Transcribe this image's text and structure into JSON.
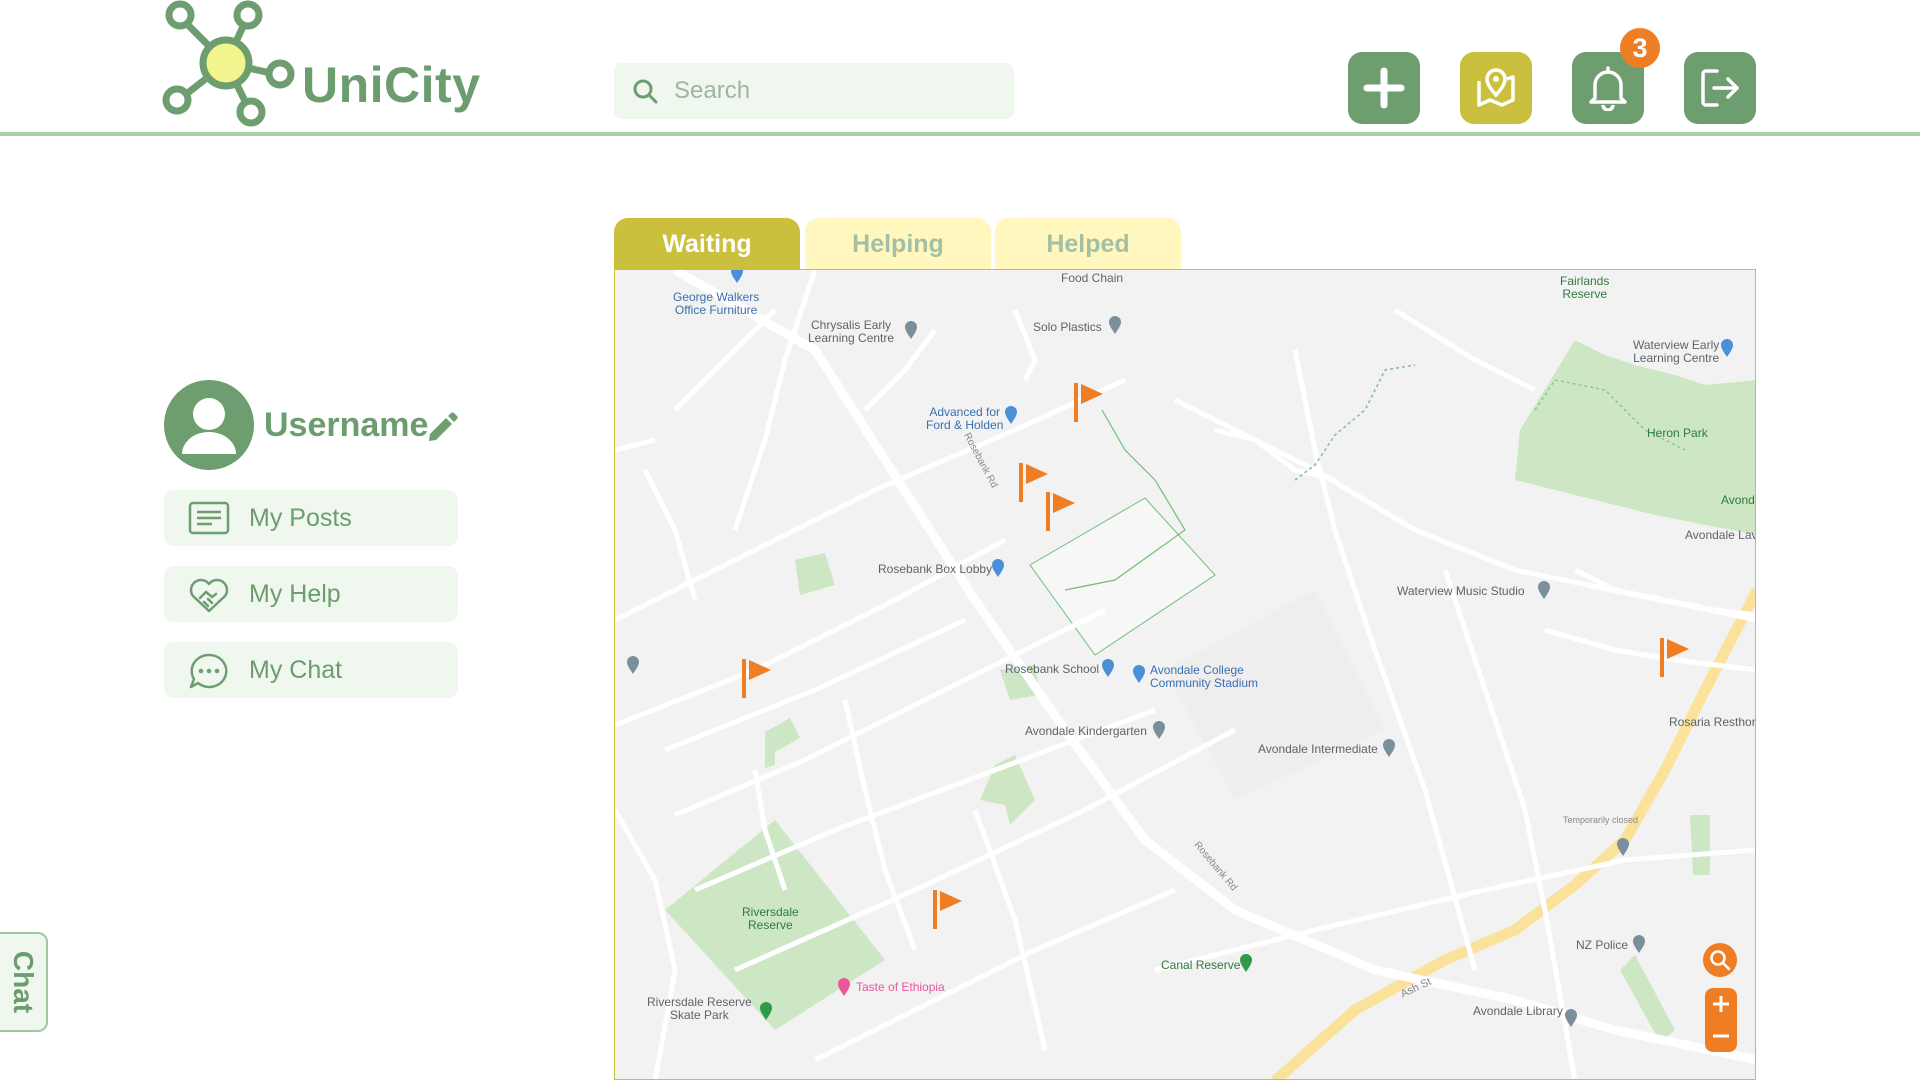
{
  "app": {
    "name": "UniCity"
  },
  "search": {
    "placeholder": "Search"
  },
  "header": {
    "notification_count": "3",
    "buttons": [
      "plus-icon",
      "map-pin-icon",
      "bell-icon",
      "logout-icon"
    ]
  },
  "profile": {
    "username": "Username"
  },
  "nav": {
    "items": [
      {
        "label": "My Posts",
        "icon": "posts-icon"
      },
      {
        "label": "My Help",
        "icon": "heart-handshake-icon"
      },
      {
        "label": "My Chat",
        "icon": "chat-bubble-icon"
      }
    ]
  },
  "tabs": [
    {
      "label": "Waiting",
      "active": true
    },
    {
      "label": "Helping",
      "active": false
    },
    {
      "label": "Helped",
      "active": false
    }
  ],
  "chat_tab": {
    "label": "Chat"
  },
  "map": {
    "labels": {
      "george": "George Walkers",
      "george2": "Office Furniture",
      "chrysalis": "Chrysalis Early",
      "chrysalis2": "Learning Centre",
      "foodchain": "Food Chain",
      "solo": "Solo Plastics",
      "fairlands": "Fairlands",
      "fairlands2": "Reserve",
      "waterview_early": "Waterview Early",
      "waterview_early2": "Learning Centre",
      "heron": "Heron Park",
      "advanced": "Advanced for",
      "advanced2": "Ford & Holden",
      "avondale_lav": "Avondale Lav",
      "rosebank_box": "Rosebank Box Lobby",
      "waterview_music": "Waterview Music Studio",
      "rosebank_school": "Rosebank School",
      "avondale_college": "Avondale College",
      "avondale_college2": "Community Stadium",
      "avondale_kinder": "Avondale Kindergarten",
      "avondale_inter": "Avondale Intermediate",
      "rosaria": "Rosaria Resthor",
      "temp_closed": "Temporarily closed",
      "riversdale": "Riversdale",
      "riversdale2": "Reserve",
      "canal": "Canal Reserve",
      "nz_police": "NZ Police",
      "riversdale_skate": "Riversdale Reserve",
      "riversdale_skate2": "Skate Park",
      "taste": "Taste of Ethiopia",
      "avondale_library": "Avondale Library",
      "rosebank_rd": "Rosebank Rd",
      "rosebank_rd2": "Rosebank Rd",
      "ash_st": "Ash St",
      "avonda": "Avonda"
    },
    "request_flags": 6
  },
  "colors": {
    "primary_green": "#6e9e70",
    "accent_yellow": "#cbc03e",
    "light_yellow": "#fff7bd",
    "light_green": "#f0f7ef",
    "orange": "#ef7d24"
  }
}
